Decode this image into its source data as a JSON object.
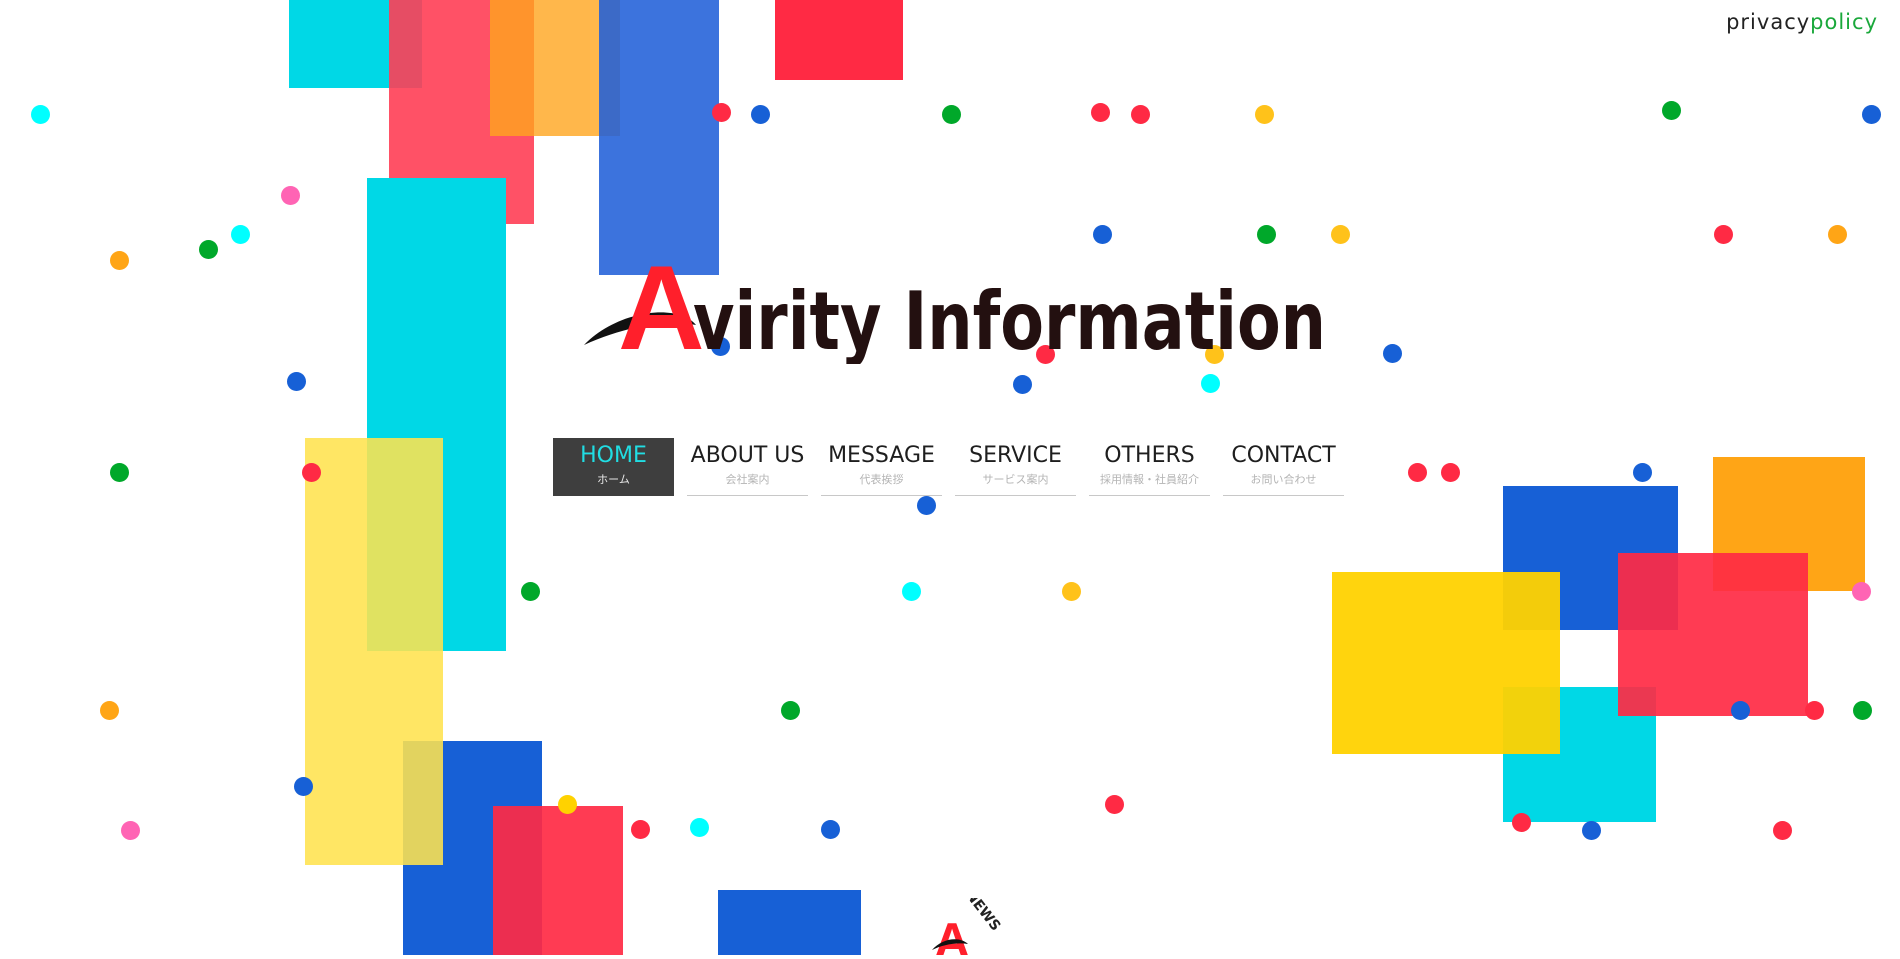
{
  "header": {
    "privacy_word1": "privacy",
    "privacy_word2": "policy",
    "privacy_colors": {
      "word1": "#222222",
      "word2": "#1aa83b"
    }
  },
  "logo": {
    "initial": "A",
    "rest": "virity Information",
    "colors": {
      "initial": "#ff1f2b",
      "text": "#231010",
      "swoosh": "#111111"
    }
  },
  "nav": {
    "items": [
      {
        "label": "HOME",
        "sub": "ホーム",
        "active": true
      },
      {
        "label": "ABOUT US",
        "sub": "会社案内",
        "active": false
      },
      {
        "label": "MESSAGE",
        "sub": "代表挨拶",
        "active": false
      },
      {
        "label": "SERVICE",
        "sub": "サービス案内",
        "active": false
      },
      {
        "label": "OTHERS",
        "sub": "採用情報・社員紹介",
        "active": false
      },
      {
        "label": "CONTACT",
        "sub": "お問い合わせ",
        "active": false
      }
    ],
    "colors": {
      "active_bg": "#3e3e3e",
      "active_text": "#21dde3",
      "text": "#1e1e1e",
      "sub_text": "#b4b4b4"
    }
  },
  "news_badge": {
    "text": "NEWS",
    "initial": "A"
  },
  "palette": {
    "cyan": "#00d8e6",
    "red": "#ff2a44",
    "blue": "#1760d6",
    "yellow": "#ffe24e",
    "gold": "#ffd200",
    "orange": "#ffa516",
    "green": "#00a82a",
    "pink": "#ff64b4",
    "lightcyan": "#00ffff"
  }
}
